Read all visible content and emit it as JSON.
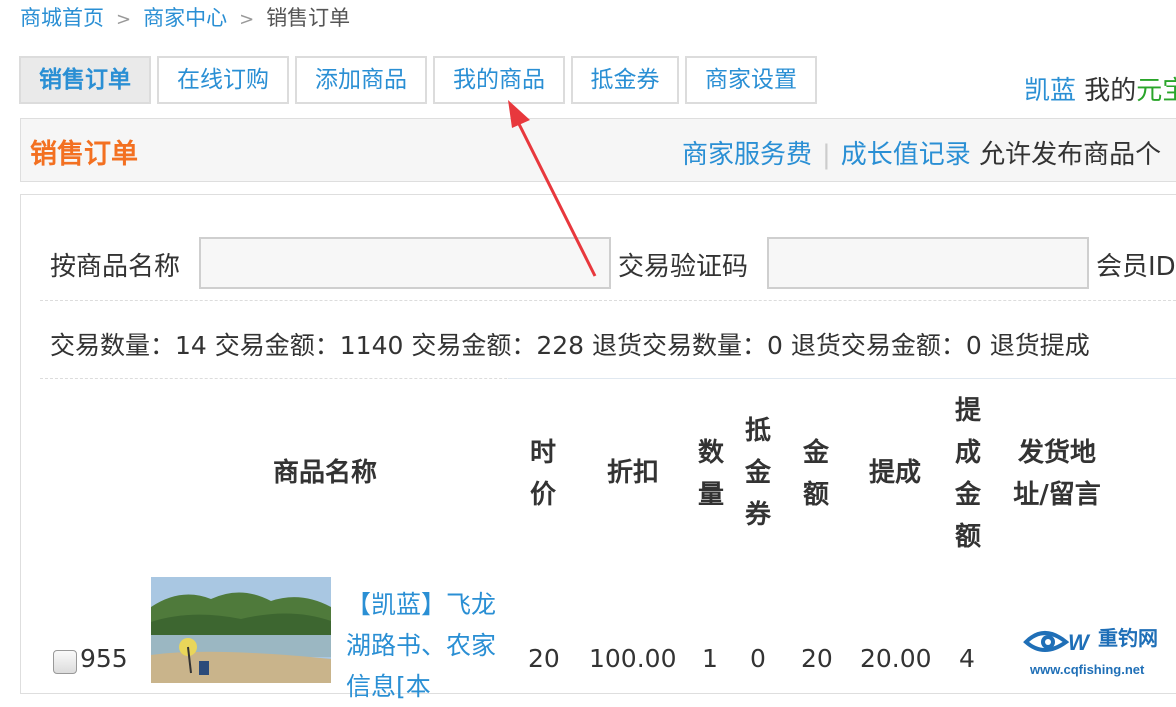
{
  "breadcrumb": {
    "items": [
      "商城首页",
      "商家中心"
    ],
    "separator": ">",
    "current": "销售订单"
  },
  "tabs": [
    {
      "label": "销售订单",
      "active": true
    },
    {
      "label": "在线订购",
      "active": false
    },
    {
      "label": "添加商品",
      "active": false
    },
    {
      "label": "我的商品",
      "active": false
    },
    {
      "label": "抵金券",
      "active": false
    },
    {
      "label": "商家设置",
      "active": false
    }
  ],
  "user": {
    "name": "凯蓝",
    "mine": "我的",
    "green_text": "元宝"
  },
  "section": {
    "title": "销售订单",
    "links": [
      "商家服务费",
      "成长值记录"
    ],
    "separator": "|",
    "text": "允许发布商品个"
  },
  "filters": {
    "product_name_label": "按商品名称",
    "product_name_value": "",
    "code_label": "交易验证码",
    "code_value": "",
    "member_label": "会员ID"
  },
  "stats": "交易数量：14 交易金额：1140 交易金额：228 退货交易数量：0 退货交易金额：0 退货提成",
  "table": {
    "headers": {
      "name": "商品名称",
      "price": "时价",
      "discount": "折扣",
      "qty": "数量",
      "coupon": "抵金券",
      "amount": "金额",
      "commission": "提成",
      "commission_amount": "提成金额",
      "address": "发货地址/留言"
    },
    "rows": [
      {
        "id": "955",
        "name": "【凯蓝】飞龙湖路书、农家信息[本",
        "price": "20",
        "discount": "100.00",
        "qty": "1",
        "coupon": "0",
        "amount": "20",
        "commission": "20.00",
        "commission_amount": "4"
      }
    ]
  },
  "watermark": {
    "logo_text": "重钓网",
    "url": "www.cqfishing.net"
  },
  "colors": {
    "link": "#2a8fd4",
    "title_orange": "#f37021",
    "arrow_red": "#e8383d",
    "green": "#2aa52a"
  }
}
